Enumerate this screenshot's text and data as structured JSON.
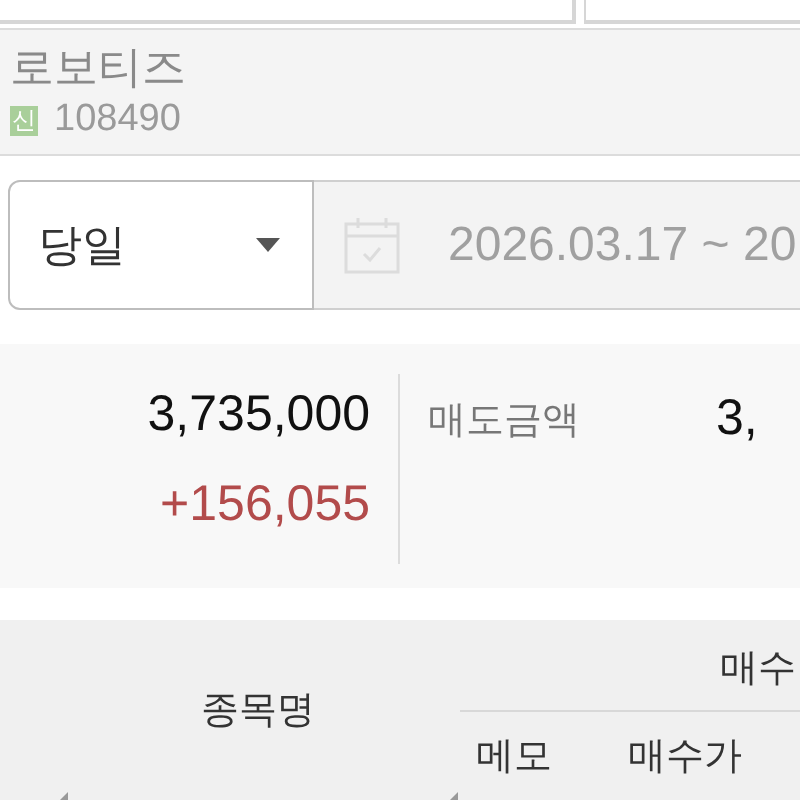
{
  "stock": {
    "name": "로보티즈",
    "badge": "신",
    "code": "108490"
  },
  "period": {
    "value": "당일",
    "date_range": "2026.03.17 ~ 20"
  },
  "summary": {
    "amount": "3,735,000",
    "change": "+156,055",
    "sell_label": "매도금액",
    "sell_amount": "3,"
  },
  "table": {
    "columns": [
      {
        "label": "종목명"
      },
      {
        "label": "매수",
        "children": [
          {
            "label": "메모"
          },
          {
            "label": "매수가"
          }
        ]
      }
    ]
  }
}
